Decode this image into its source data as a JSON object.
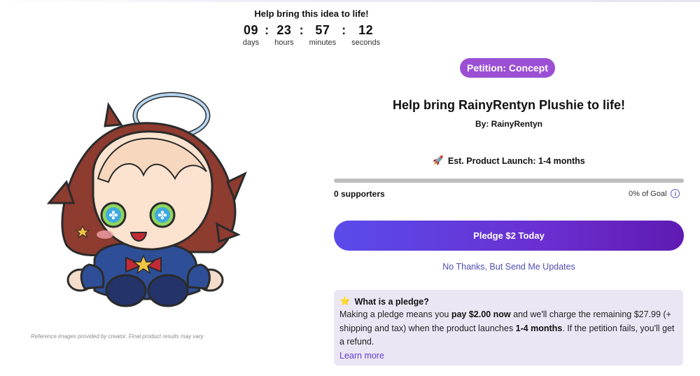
{
  "countdown": {
    "heading": "Help bring this idea to life!",
    "days": "09",
    "days_label": "days",
    "hours": "23",
    "hours_label": "hours",
    "minutes": "57",
    "minutes_label": "minutes",
    "seconds": "12",
    "seconds_label": "seconds",
    "separator": ":"
  },
  "image": {
    "disclaimer": "Reference images provided by creator. Final product results may vary."
  },
  "product": {
    "badge": "Petition: Concept",
    "title": "Help bring RainyRentyn Plushie to life!",
    "creator": "By: RainyRentyn",
    "launch_estimate": "Est. Product Launch: 1-4 months",
    "supporters": "0 supporters",
    "goal": "0% of Goal",
    "progress_fraction": 0
  },
  "actions": {
    "pledge_button": "Pledge $2 Today",
    "no_thanks": "No Thanks, But Send Me Updates"
  },
  "pledge_info": {
    "title": "What is a pledge?",
    "text_1": "Making a pledge means you ",
    "text_2": "pay $2.00 now",
    "text_3": " and we'll charge the remaining $27.99 (+ shipping and tax) when the product launches ",
    "text_4": "1-4 months",
    "text_5": ". If the petition fails, you'll get a refund.",
    "learn_more": "Learn more"
  },
  "colors": {
    "badge": "#9b4fd4",
    "pledge_button_start": "#5a4bea",
    "pledge_button_end": "#5f1ab2",
    "info_box": "#ebe6f4",
    "link": "#4d4db3"
  }
}
